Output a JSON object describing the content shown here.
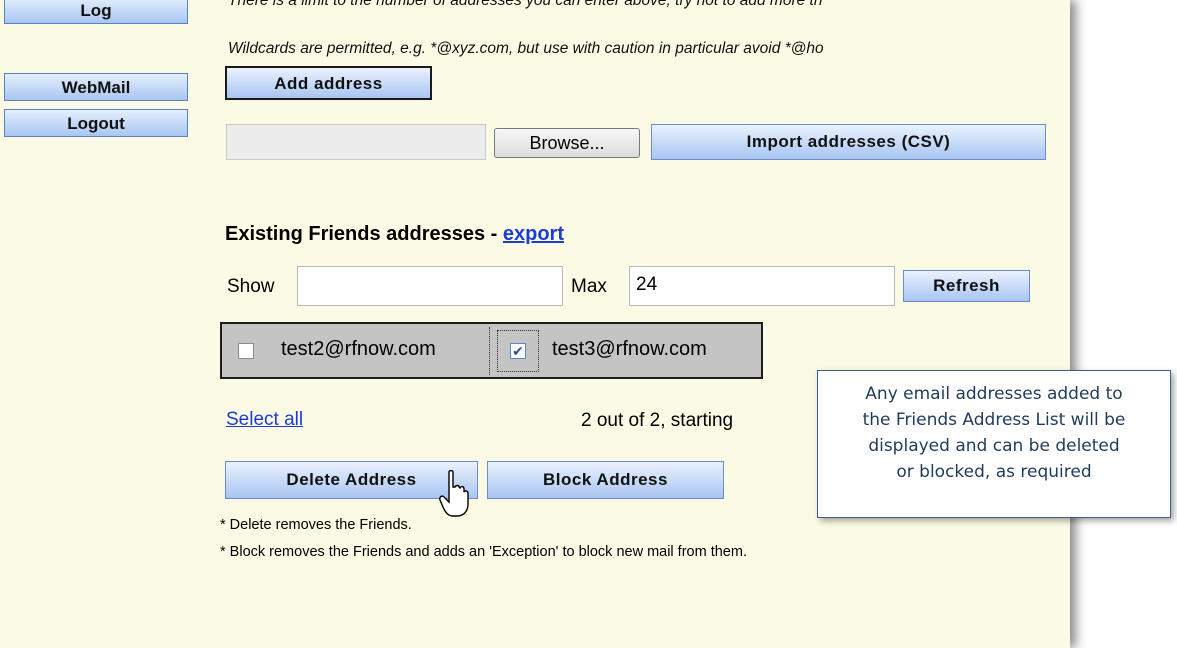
{
  "nav": {
    "log_label": "Log",
    "webmail_label": "WebMail",
    "logout_label": "Logout"
  },
  "instructions": {
    "line1": "There is a limit to the number of addresses you can enter above, try not to add more th",
    "line2": "Wildcards are permitted, e.g. *@xyz.com, but use with caution in particular avoid *@ho"
  },
  "add_address_label": "Add address",
  "import": {
    "file_value": "",
    "browse_label": "Browse...",
    "import_label": "Import addresses (CSV)"
  },
  "existing": {
    "heading": "Existing Friends addresses - ",
    "export_link": "export"
  },
  "filter": {
    "show_label": "Show",
    "show_value": "",
    "max_label": "Max",
    "max_value": "24",
    "refresh_label": "Refresh"
  },
  "addresses": [
    {
      "email": "test2@rfnow.com",
      "checked": false
    },
    {
      "email": "test3@rfnow.com",
      "checked": true
    }
  ],
  "select_all_label": "Select all",
  "pagination_text": "2 out of 2, starting",
  "actions": {
    "delete_label": "Delete Address",
    "block_label": "Block Address"
  },
  "notes": {
    "note1": "* Delete removes the Friends.",
    "note2": "* Block removes the Friends and adds an 'Exception' to block new mail from them."
  },
  "callout": {
    "line1": "Any email addresses added to",
    "line2": "the Friends Address List will be",
    "line3": "displayed and can be deleted",
    "line4": "or blocked, as required"
  },
  "icons": {
    "cursor": "mouse-pointer-icon",
    "checkmark": "checkmark-icon"
  },
  "colors": {
    "panel_bg": "#fbfbe5",
    "button_top": "#eaf2fe",
    "button_bottom": "#a8c5f2",
    "link": "#1a3bd6",
    "callout_text": "#1f3b5c"
  }
}
